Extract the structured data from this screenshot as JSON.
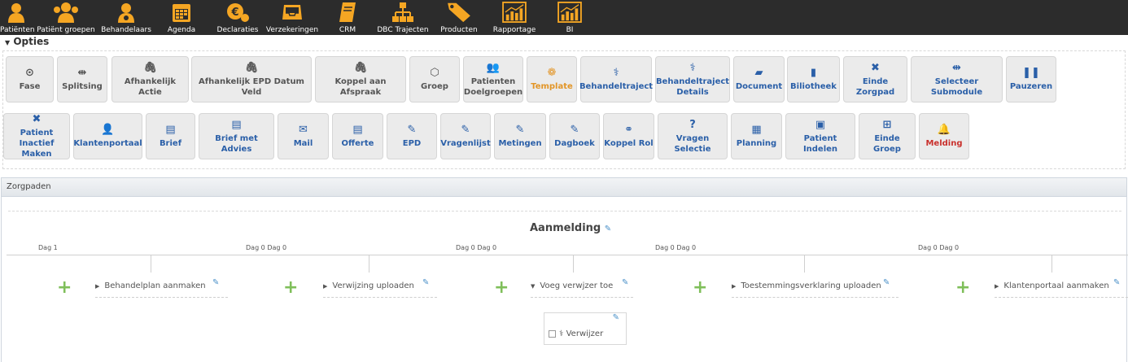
{
  "nav": {
    "items": [
      {
        "label": "Patiënten",
        "icon": "patient-icon"
      },
      {
        "label": "Patiënt groepen",
        "icon": "patient-group-icon"
      },
      {
        "label": "Behandelaars",
        "icon": "doctor-icon"
      },
      {
        "label": "Agenda",
        "icon": "calendar-icon"
      },
      {
        "label": "Declaraties",
        "icon": "euro-coins-icon"
      },
      {
        "label": "Verzekeringen",
        "icon": "inbox-icon"
      },
      {
        "label": "CRM",
        "icon": "notebook-icon"
      },
      {
        "label": "DBC Trajecten",
        "icon": "sitemap-icon"
      },
      {
        "label": "Producten",
        "icon": "tag-icon"
      },
      {
        "label": "Rapportage",
        "icon": "report-chart-icon"
      },
      {
        "label": "BI",
        "icon": "bi-chart-icon"
      }
    ],
    "accent": "#f5a623",
    "background": "#2c2c2c"
  },
  "opties": {
    "title": "Opties",
    "row1": [
      {
        "label": "Fase",
        "glyph": "⊙",
        "tone": "grey"
      },
      {
        "label": "Splitsing",
        "glyph": "⇹",
        "tone": "grey"
      },
      {
        "label": "Afhankelijk Actie",
        "glyph": "🖇",
        "tone": "grey"
      },
      {
        "label": "Afhankelijk EPD Datum Veld",
        "glyph": "🖇",
        "tone": "grey"
      },
      {
        "label": "Koppel aan Afspraak",
        "glyph": "🖇",
        "tone": "grey"
      },
      {
        "label": "Groep",
        "glyph": "⬡",
        "tone": "grey"
      },
      {
        "label": "Patienten Doelgroepen",
        "glyph": "👥",
        "tone": "grey"
      },
      {
        "label": "Template",
        "glyph": "❁",
        "tone": "orange"
      },
      {
        "label": "Behandeltraject",
        "glyph": "⚕",
        "tone": "blue"
      },
      {
        "label": "Behandeltraject Details",
        "glyph": "⚕",
        "tone": "blue"
      },
      {
        "label": "Document",
        "glyph": "▰",
        "tone": "blue"
      },
      {
        "label": "Biliotheek",
        "glyph": "▮",
        "tone": "blue"
      },
      {
        "label": "Einde Zorgpad",
        "glyph": "✖",
        "tone": "blue"
      },
      {
        "label": "Selecteer Submodule",
        "glyph": "⇹",
        "tone": "blue"
      },
      {
        "label": "Pauzeren",
        "glyph": "❚❚",
        "tone": "blue"
      }
    ],
    "row2": [
      {
        "label": "Patient Inactief Maken",
        "glyph": "✖",
        "tone": "blue"
      },
      {
        "label": "Klantenportaal",
        "glyph": "👤",
        "tone": "blue"
      },
      {
        "label": "Brief",
        "glyph": "▤",
        "tone": "blue"
      },
      {
        "label": "Brief met Advies",
        "glyph": "▤",
        "tone": "blue"
      },
      {
        "label": "Mail",
        "glyph": "✉",
        "tone": "blue"
      },
      {
        "label": "Offerte",
        "glyph": "▤",
        "tone": "blue"
      },
      {
        "label": "EPD",
        "glyph": "✎",
        "tone": "blue"
      },
      {
        "label": "Vragenlijst",
        "glyph": "✎",
        "tone": "blue"
      },
      {
        "label": "Metingen",
        "glyph": "✎",
        "tone": "blue"
      },
      {
        "label": "Dagboek",
        "glyph": "✎",
        "tone": "blue"
      },
      {
        "label": "Koppel Rol",
        "glyph": "⚭",
        "tone": "blue"
      },
      {
        "label": "Vragen Selectie",
        "glyph": "?",
        "tone": "blue"
      },
      {
        "label": "Planning",
        "glyph": "▦",
        "tone": "blue"
      },
      {
        "label": "Patient Indelen",
        "glyph": "▣",
        "tone": "blue"
      },
      {
        "label": "Einde Groep",
        "glyph": "⊞",
        "tone": "blue"
      },
      {
        "label": "Melding",
        "glyph": "🔔",
        "tone": "red"
      }
    ]
  },
  "zorgpaden": {
    "title": "Zorgpaden",
    "phase": "Aanmelding",
    "day_labels": [
      "Dag 1",
      "Dag 0 Dag 0",
      "Dag 0 Dag 0",
      "Dag 0 Dag 0",
      "Dag 0 Dag 0"
    ],
    "steps": [
      {
        "label": "Behandelplan aanmaken",
        "expanded": false
      },
      {
        "label": "Verwijzing uploaden",
        "expanded": false
      },
      {
        "label": "Voeg verwjzer toe",
        "expanded": true
      },
      {
        "label": "Toestemmingsverklaring uploaden",
        "expanded": false
      },
      {
        "label": "Klantenportaal aanmaken",
        "expanded": false
      }
    ],
    "sub_item": {
      "label": "Verwijzer",
      "checked": false
    }
  }
}
